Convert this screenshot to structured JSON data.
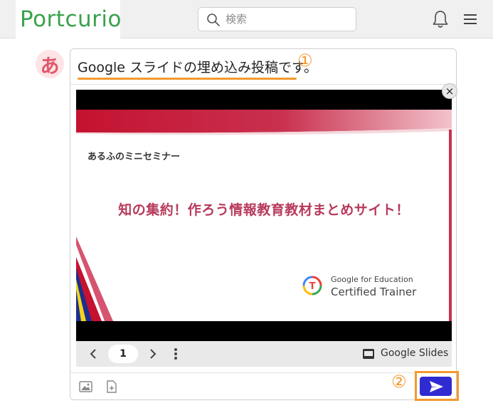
{
  "header": {
    "logo_text": "Portcurio",
    "search_placeholder": "検索",
    "search_value": ""
  },
  "post": {
    "avatar_char": "あ",
    "text": "Google スライドの埋め込み投稿です。",
    "annotation_1": "①",
    "annotation_2": "②"
  },
  "embed": {
    "close_label": "×",
    "slide_subtitle": "あるふのミニセミナー",
    "slide_title": "知の集約！作ろう情報教育教材まとめサイト！",
    "badge_line1": "Google for Education",
    "badge_line2": "Certified Trainer",
    "page_number": "1",
    "app_label": "Google Slides"
  },
  "colors": {
    "brand_green": "#3aa24b",
    "annotation_orange": "#f39a2d",
    "send_blue": "#2f2bd1",
    "slide_title": "#b73a5b"
  },
  "icons": [
    "search-icon",
    "bell-icon",
    "hamburger-menu-icon",
    "close-icon",
    "chevron-left-icon",
    "chevron-right-icon",
    "more-vertical-icon",
    "slides-icon",
    "image-icon",
    "file-add-icon",
    "send-icon"
  ]
}
